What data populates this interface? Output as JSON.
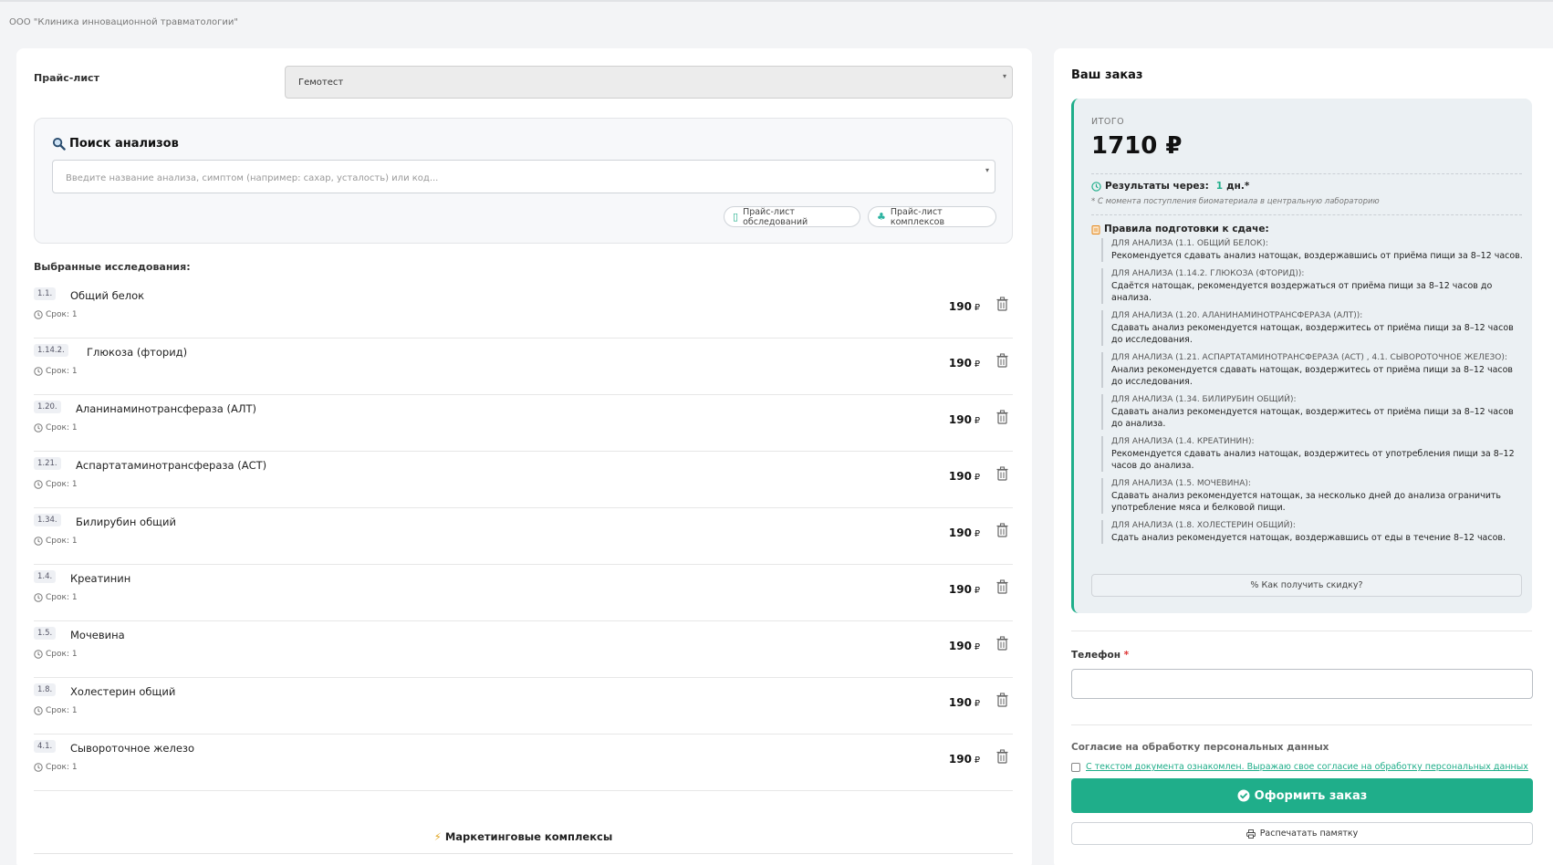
{
  "company": "ООО \"Клиника инновационной травматологии\"",
  "pricelist": {
    "label": "Прайс-лист",
    "selected": "Гемотест"
  },
  "search": {
    "title": "Поиск анализов",
    "placeholder": "Введите название анализа, симптом (например: сахар, усталость) или код...",
    "chip_exams": "Прайс-лист обследований",
    "chip_complexes": "Прайс-лист комплексов"
  },
  "selected": {
    "title": "Выбранные исследования:",
    "items": [
      {
        "code": "1.1.",
        "name": "Общий белок",
        "term": "Срок: 1",
        "price": "190",
        "currency": "₽"
      },
      {
        "code": "1.14.2.",
        "name": "Глюкоза (фторид)",
        "term": "Срок: 1",
        "price": "190",
        "currency": "₽"
      },
      {
        "code": "1.20.",
        "name": "Аланинаминотрансфераза (АЛТ)",
        "term": "Срок: 1",
        "price": "190",
        "currency": "₽"
      },
      {
        "code": "1.21.",
        "name": "Аспартатаминотрансфераза (АСТ)",
        "term": "Срок: 1",
        "price": "190",
        "currency": "₽"
      },
      {
        "code": "1.34.",
        "name": "Билирубин общий",
        "term": "Срок: 1",
        "price": "190",
        "currency": "₽"
      },
      {
        "code": "1.4.",
        "name": "Креатинин",
        "term": "Срок: 1",
        "price": "190",
        "currency": "₽"
      },
      {
        "code": "1.5.",
        "name": "Мочевина",
        "term": "Срок: 1",
        "price": "190",
        "currency": "₽"
      },
      {
        "code": "1.8.",
        "name": "Холестерин общий",
        "term": "Срок: 1",
        "price": "190",
        "currency": "₽"
      },
      {
        "code": "4.1.",
        "name": "Сывороточное железо",
        "term": "Срок: 1",
        "price": "190",
        "currency": "₽"
      }
    ]
  },
  "marketing": {
    "title": "Маркетинговые комплексы"
  },
  "order": {
    "title": "Ваш заказ",
    "total_label": "ИТОГО",
    "total": "1710 ₽",
    "results_label": "Результаты через:",
    "results_days": "1",
    "results_unit": "дн.*",
    "results_note": "* С момента поступления биоматериала в центральную лабораторию",
    "rules_title": "Правила подготовки к сдаче:",
    "rules": [
      {
        "head": "Для анализа (1.1. Общий белок):",
        "text": "Рекомендуется сдавать анализ натощак, воздержавшись от приёма пищи за 8–12 часов."
      },
      {
        "head": "Для анализа (1.14.2. Глюкоза (фторид)):",
        "text": "Сдаётся натощак, рекомендуется воздержаться от приёма пищи за 8–12 часов до анализа."
      },
      {
        "head": "Для анализа (1.20. Аланинаминотрансфераза (АЛТ)):",
        "text": "Сдавать анализ рекомендуется натощак, воздержитесь от приёма пищи за 8–12 часов до исследования."
      },
      {
        "head": "Для анализа (1.21. Аспартатаминотрансфераза (АСТ) , 4.1. Сывороточное железо):",
        "text": "Анализ рекомендуется сдавать натощак, воздержитесь от приёма пищи за 8–12 часов до исследования."
      },
      {
        "head": "Для анализа (1.34. Билирубин общий):",
        "text": "Сдавать анализ рекомендуется натощак, воздержитесь от приёма пищи за 8–12 часов до анализа."
      },
      {
        "head": "Для анализа (1.4. Креатинин):",
        "text": "Рекомендуется сдавать анализ натощак, воздержитесь от употребления пищи за 8–12 часов до анализа."
      },
      {
        "head": "Для анализа (1.5. Мочевина):",
        "text": "Сдавать анализ рекомендуется натощак, за несколько дней до анализа ограничить употребление мяса и белковой пищи."
      },
      {
        "head": "Для анализа (1.8. Холестерин общий):",
        "text": "Сдать анализ рекомендуется натощак, воздержавшись от еды в течение 8–12 часов."
      }
    ],
    "discount_label": "% Как получить скидку?",
    "phone_label": "Телефон",
    "phone_required": "*",
    "consent_title": "Согласие на обработку персональных данных",
    "consent_link": "С текстом документа ознакомлен. Выражаю свое согласие на обработку персональных данных",
    "submit_label": "Оформить заказ",
    "print_label": "Распечатать памятку"
  },
  "colors": {
    "accent": "#1fae8a",
    "background": "#f3f4f6"
  }
}
